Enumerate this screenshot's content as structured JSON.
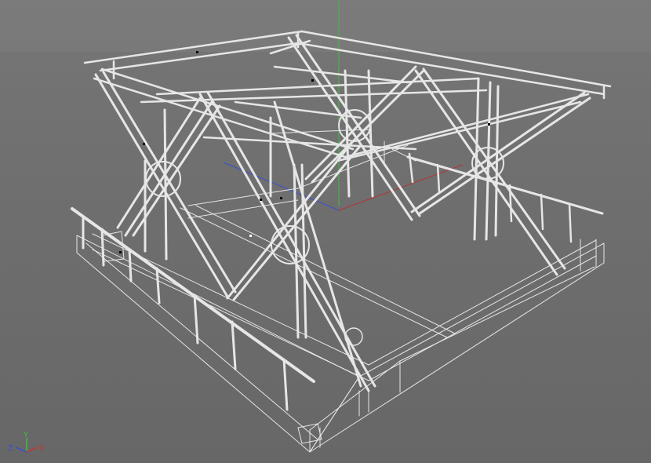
{
  "viewport": {
    "background": "#6e6e6e",
    "wire_color": "#e6e6e6",
    "y_axis_color": "#3fbf3f",
    "x_axis_color": "#b33333",
    "z_axis_color": "#3a4fcf"
  },
  "axis_gizmo": {
    "x_label": "X",
    "y_label": "Y",
    "z_label": "Z"
  }
}
